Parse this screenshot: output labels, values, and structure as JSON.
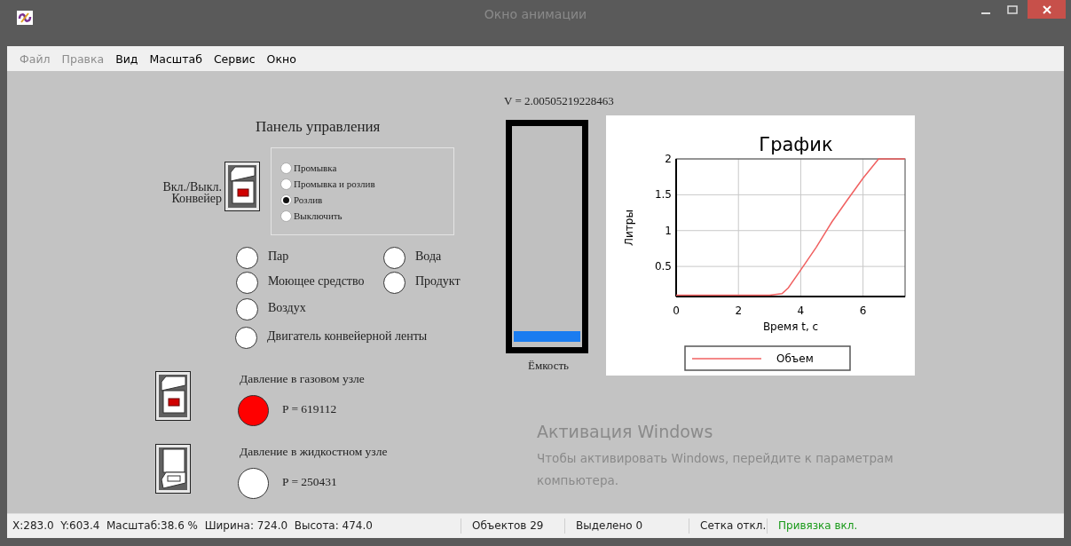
{
  "window": {
    "title": "Окно анимации"
  },
  "menu": [
    {
      "label": "Файл",
      "disabled": true
    },
    {
      "label": "Правка",
      "disabled": true
    },
    {
      "label": "Вид",
      "disabled": false
    },
    {
      "label": "Масштаб",
      "disabled": false
    },
    {
      "label": "Сервис",
      "disabled": false
    },
    {
      "label": "Окно",
      "disabled": false
    }
  ],
  "canvas": {
    "panel_title": "Панель управления",
    "conveyor_switch": {
      "label": "Вкл./Выкл. Конвейер",
      "on": true
    },
    "mode_options": [
      {
        "label": "Промывка",
        "selected": false
      },
      {
        "label": "Промывка и розлив",
        "selected": false
      },
      {
        "label": "Розлив",
        "selected": true
      },
      {
        "label": "Выключить",
        "selected": false
      }
    ],
    "indicators": [
      {
        "label": "Пар",
        "on": false
      },
      {
        "label": "Вода",
        "on": false
      },
      {
        "label": "Моющее средство",
        "on": false
      },
      {
        "label": "Продукт",
        "on": false
      },
      {
        "label": "Воздух",
        "on": false
      },
      {
        "label": "Двигатель конвейерной ленты",
        "on": false
      }
    ],
    "pressure_nodes": [
      {
        "label": "Давление в газовом узле",
        "switch_on": true,
        "alarm": true,
        "reading": "P = 619112"
      },
      {
        "label": "Давление в жидкостном узле",
        "switch_on": false,
        "alarm": false,
        "reading": "P = 250431"
      }
    ],
    "tank": {
      "reading": "V = 2.00505219228463",
      "level": 0.05,
      "label": "Ёмкость"
    },
    "chart_data": {
      "type": "line",
      "title": "График",
      "xlabel": "Время t, с",
      "ylabel": "Литры",
      "x": [
        0,
        1,
        2,
        3,
        3.4,
        3.6,
        4,
        4.5,
        5,
        5.5,
        6,
        6.5,
        7.35
      ],
      "series": [
        {
          "name": "Объем",
          "color": "#f06060",
          "values": [
            0.1,
            0.1,
            0.1,
            0.1,
            0.12,
            0.2,
            0.45,
            0.77,
            1.12,
            1.43,
            1.73,
            2,
            2
          ]
        }
      ],
      "xlim": [
        0,
        7.35
      ],
      "ylim": [
        0.08,
        2
      ],
      "grid": true,
      "xticks": [
        0,
        2,
        4,
        6
      ],
      "yticks": [
        0.5,
        1,
        1.5,
        2
      ]
    },
    "activation_notice": {
      "title": "Активация Windows",
      "text": "Чтобы активировать Windows, перейдите к параметрам компьютера."
    }
  },
  "status_bar": [
    {
      "text": "X:283.0  Y:603.4  Масштаб:38.6 %  Ширина: 724.0  Высота: 474.0",
      "highlighted": false
    },
    {
      "text": "Объектов 29",
      "highlighted": false
    },
    {
      "text": "Выделено 0",
      "highlighted": false
    },
    {
      "text": "Сетка откл.",
      "highlighted": false
    },
    {
      "text": "Привязка вкл.",
      "highlighted": true
    }
  ]
}
